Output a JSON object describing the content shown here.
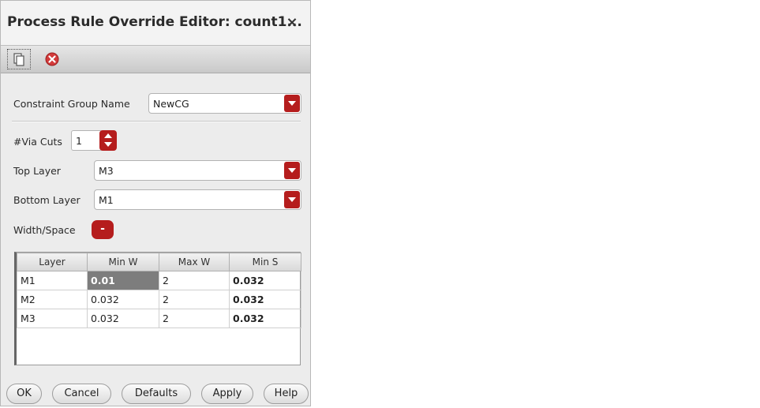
{
  "dialog": {
    "title": "Process Rule Override Editor: count1...",
    "close_glyph": "×"
  },
  "toolbar": {
    "copy_icon": "copy-icon",
    "delete_icon": "delete-icon"
  },
  "form": {
    "constraint_group_label": "Constraint Group Name",
    "constraint_group_value": "NewCG",
    "via_cuts_label": "#Via Cuts",
    "via_cuts_value": "1",
    "top_layer_label": "Top Layer",
    "top_layer_value": "M3",
    "bottom_layer_label": "Bottom Layer",
    "bottom_layer_value": "M1",
    "width_space_label": "Width/Space",
    "width_space_button": "-"
  },
  "table": {
    "headers": [
      "Layer",
      "Min W",
      "Max W",
      "Min S"
    ],
    "rows": [
      [
        "M1",
        "0.01",
        "2",
        "0.032"
      ],
      [
        "M2",
        "0.032",
        "2",
        "0.032"
      ],
      [
        "M3",
        "0.032",
        "2",
        "0.032"
      ]
    ]
  },
  "buttons": {
    "ok": "OK",
    "cancel": "Cancel",
    "defaults": "Defaults",
    "apply": "Apply",
    "help": "Help"
  },
  "colors": {
    "accent": "#b51d1d",
    "selected_cell": "#7d7d7d"
  }
}
